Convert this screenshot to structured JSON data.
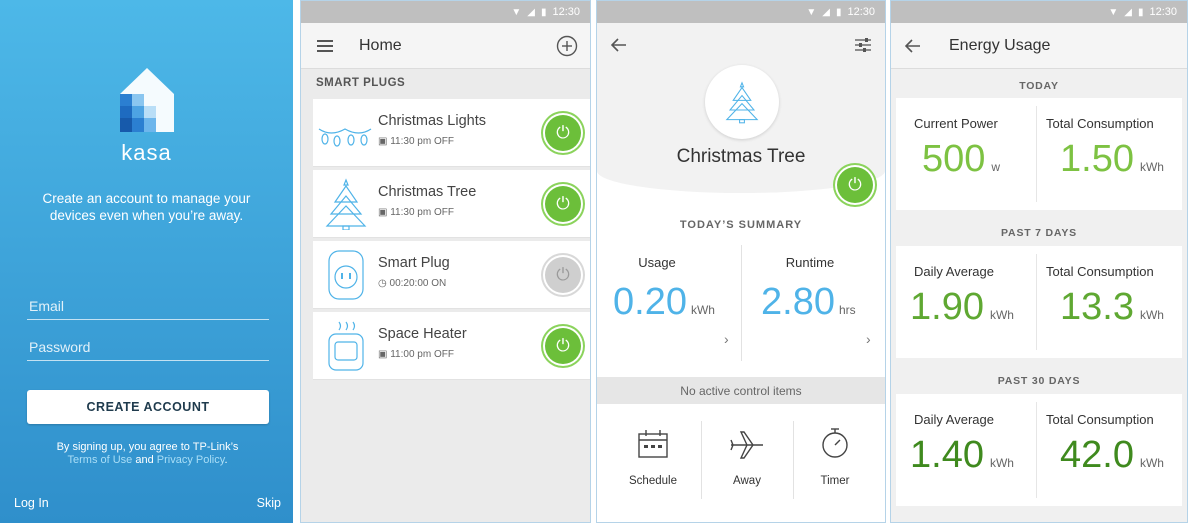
{
  "status": {
    "time": "12:30"
  },
  "signup": {
    "brand": "kasa",
    "tagline": "Create an account to manage your devices even when you’re away.",
    "email_placeholder": "Email",
    "password_placeholder": "Password",
    "create_button": "CREATE ACCOUNT",
    "terms_prefix": "By signing up, you agree to TP-Link’s",
    "terms_link": "Terms of Use",
    "terms_and": "and",
    "privacy_link": "Privacy Policy",
    "terms_end": ".",
    "login": "Log In",
    "skip": "Skip"
  },
  "home": {
    "title": "Home",
    "section": "SMART PLUGS",
    "devices": [
      {
        "name": "Christmas Lights",
        "schedule": "11:30 pm OFF",
        "sub_icon": "calendar-icon",
        "state": "on"
      },
      {
        "name": "Christmas Tree",
        "schedule": "11:30 pm OFF",
        "sub_icon": "calendar-icon",
        "state": "on"
      },
      {
        "name": "Smart Plug",
        "schedule": "00:20:00 ON",
        "sub_icon": "timer-icon",
        "state": "off"
      },
      {
        "name": "Space Heater",
        "schedule": "11:00 pm OFF",
        "sub_icon": "calendar-icon",
        "state": "on"
      }
    ]
  },
  "detail": {
    "device_name": "Christmas Tree",
    "summary_label": "TODAY’S SUMMARY",
    "usage_label": "Usage",
    "usage_value": "0.20",
    "usage_unit": "kWh",
    "runtime_label": "Runtime",
    "runtime_value": "2.80",
    "runtime_unit": "hrs",
    "no_control": "No active control items",
    "controls": [
      "Schedule",
      "Away",
      "Timer"
    ]
  },
  "energy": {
    "title": "Energy Usage",
    "periods": [
      {
        "label": "TODAY",
        "left_label": "Current Power",
        "left_value": "500",
        "left_unit": "w",
        "right_label": "Total Consumption",
        "right_value": "1.50",
        "right_unit": "kWh",
        "color": "#7dc242"
      },
      {
        "label": "PAST 7 DAYS",
        "left_label": "Daily Average",
        "left_value": "1.90",
        "left_unit": "kWh",
        "right_label": "Total Consumption",
        "right_value": "13.3",
        "right_unit": "kWh",
        "color": "#5fa832"
      },
      {
        "label": "PAST 30 DAYS",
        "left_label": "Daily Average",
        "left_value": "1.40",
        "left_unit": "kWh",
        "right_label": "Total Consumption",
        "right_value": "42.0",
        "right_unit": "kWh",
        "color": "#3f8a1e"
      }
    ]
  },
  "colors": {
    "accent_blue": "#4fb3e8",
    "power_green": "#6cbf3a"
  }
}
